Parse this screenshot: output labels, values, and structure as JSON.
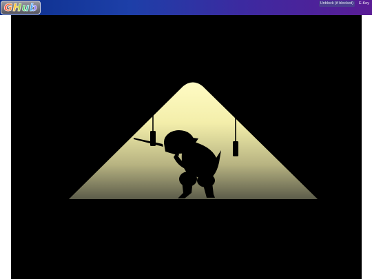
{
  "header": {
    "logo_text": "GHub",
    "unblock_label": "Unblock (if blocked)",
    "ekey_label": "E-Key"
  },
  "colors": {
    "topbar_left": "#0b2f8c",
    "topbar_right": "#5a1c95",
    "game_background": "#000000",
    "spotlight_top": "#fffac0",
    "spotlight_bottom": "#6b6b55",
    "silhouette": "#000000"
  },
  "game": {
    "scene": "silhouette character under spotlight"
  }
}
